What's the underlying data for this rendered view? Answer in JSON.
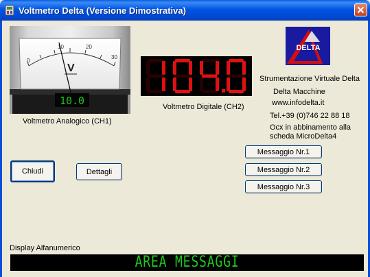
{
  "window": {
    "title": "Voltmetro Delta (Versione Dimostrativa)"
  },
  "analog": {
    "scale_labels": [
      "0",
      "10",
      "20",
      "30"
    ],
    "unit": "V",
    "readout": "10.0",
    "caption": "Voltmetro Analogico (CH1)"
  },
  "digital": {
    "digits": [
      "1",
      "0",
      "4",
      "0"
    ],
    "caption": "Voltmetro Digitale (CH2)"
  },
  "logo": {
    "text": "DELTA"
  },
  "info": {
    "line1": "Strumentazione Virtuale Delta",
    "line2": "Delta Macchine",
    "line3": "www.infodelta.it",
    "line4": "Tel.+39 (0)746 22 88 18",
    "line5": "Ocx in abbinamento alla",
    "line6": "scheda MicroDelta4"
  },
  "buttons": {
    "chiudi": "Chiudi",
    "dettagli": "Dettagli",
    "msg1": "Messaggio Nr.1",
    "msg2": "Messaggio Nr.2",
    "msg3": "Messaggio Nr.3"
  },
  "display": {
    "label": "Display Alfanumerico",
    "text": "AREA MESSAGGI"
  },
  "colors": {
    "segment_on": "#E01010",
    "segment_off": "#2A0000",
    "lcd_green": "#1EC81E",
    "titlebar": "#0055E5"
  }
}
